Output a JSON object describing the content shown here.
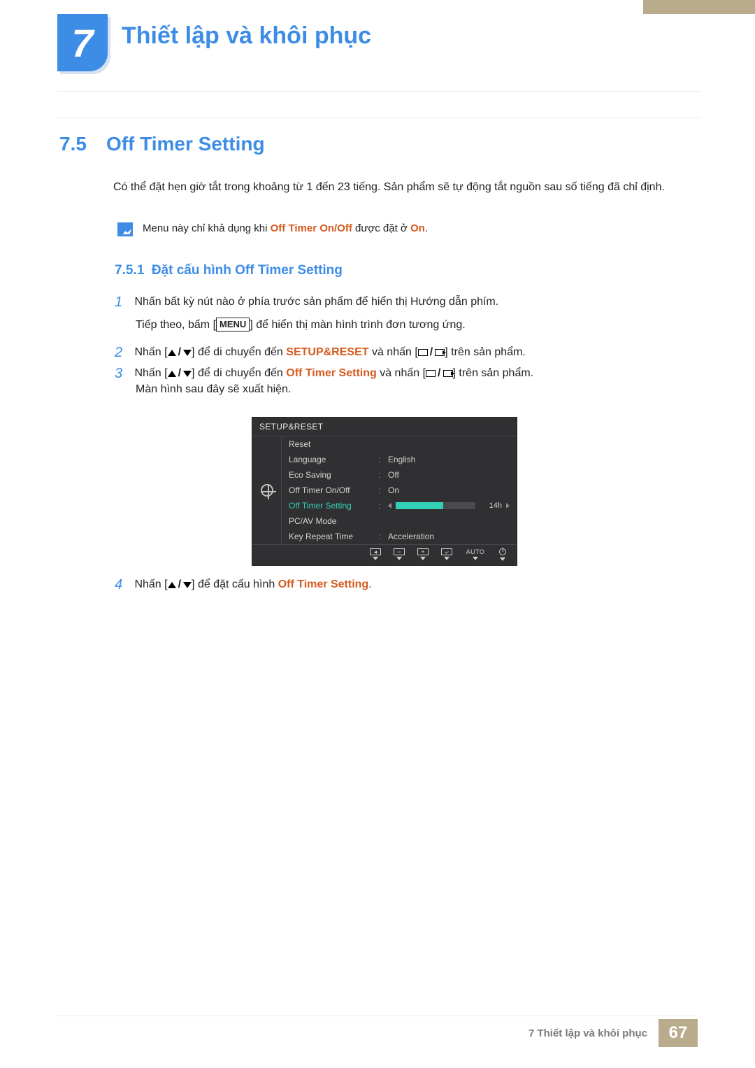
{
  "chapter": {
    "number": "7",
    "title": "Thiết lập và khôi phục"
  },
  "section": {
    "number": "7.5",
    "title": "Off Timer Setting"
  },
  "intro": "Có thể đặt hẹn giờ tắt trong khoảng từ 1 đến 23 tiếng. Sản phẩm sẽ tự động tắt nguồn sau số tiếng đã chỉ định.",
  "note": {
    "pre": "Menu này chỉ khả dụng khi ",
    "hl1": "Off Timer On/Off",
    "mid": " được đặt ở ",
    "hl2": "On",
    "post": "."
  },
  "subsection": {
    "number": "7.5.1",
    "title": "Đặt cấu hình Off Timer Setting"
  },
  "steps": {
    "s1": {
      "num": "1",
      "text": "Nhấn bất kỳ nút nào ở phía trước sản phẩm để hiển thị Hướng dẫn phím."
    },
    "s1b": {
      "pre": "Tiếp theo, bấm [",
      "menu": "MENU",
      "post": "] để hiển thị màn hình trình đơn tương ứng."
    },
    "s2": {
      "num": "2",
      "pre": "Nhấn [",
      "mid1": "] để di chuyển đến ",
      "hl": "SETUP&RESET",
      "mid2": " và nhấn [",
      "post": "] trên sản phẩm."
    },
    "s3": {
      "num": "3",
      "pre": "Nhấn [",
      "mid1": "] để di chuyển đến ",
      "hl": "Off Timer Setting",
      "mid2": " và nhấn [",
      "post": "] trên sản phẩm."
    },
    "s3b": "Màn hình sau đây sẽ xuất hiện.",
    "s4": {
      "num": "4",
      "pre": "Nhấn [",
      "mid": "] để đặt cấu hình ",
      "hl": "Off Timer Setting",
      "post": "."
    }
  },
  "osd": {
    "title": "SETUP&RESET",
    "rows": [
      {
        "label": "Reset",
        "val": ""
      },
      {
        "label": "Language",
        "val": "English"
      },
      {
        "label": "Eco Saving",
        "val": "Off"
      },
      {
        "label": "Off Timer On/Off",
        "val": "On"
      },
      {
        "label": "Off Timer Setting",
        "val": "14h",
        "selected": true
      },
      {
        "label": "PC/AV Mode",
        "val": ""
      },
      {
        "label": "Key Repeat Time",
        "val": "Acceleration"
      }
    ],
    "footer_auto": "AUTO"
  },
  "footer": {
    "text": "7 Thiết lập và khôi phục",
    "page": "67"
  }
}
